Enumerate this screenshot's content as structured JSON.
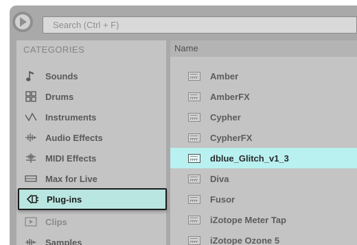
{
  "search": {
    "placeholder": "Search (Ctrl + F)"
  },
  "categories": {
    "header": "CATEGORIES",
    "items": [
      {
        "label": "Sounds",
        "icon": "music-note-icon"
      },
      {
        "label": "Drums",
        "icon": "drum-grid-icon"
      },
      {
        "label": "Instruments",
        "icon": "waveform-icon"
      },
      {
        "label": "Audio Effects",
        "icon": "audio-effects-icon"
      },
      {
        "label": "MIDI Effects",
        "icon": "midi-effects-icon"
      },
      {
        "label": "Max for Live",
        "icon": "max-for-live-icon"
      },
      {
        "label": "Plug-ins",
        "icon": "plugin-icon",
        "selected": true
      },
      {
        "label": "Clips",
        "icon": "clip-icon"
      },
      {
        "label": "Samples",
        "icon": "sample-waveform-icon"
      }
    ]
  },
  "list": {
    "column_header": "Name",
    "items": [
      {
        "label": "Amber"
      },
      {
        "label": "AmberFX"
      },
      {
        "label": "Cypher"
      },
      {
        "label": "CypherFX"
      },
      {
        "label": "dblue_Glitch_v1_3",
        "selected": true
      },
      {
        "label": "Diva"
      },
      {
        "label": "Fusor"
      },
      {
        "label": "iZotope Meter Tap"
      },
      {
        "label": "iZotope Ozone 5"
      }
    ]
  },
  "colors": {
    "selection": "#b9e6e1",
    "panel": "#c4c4c4",
    "frame": "#a9a9a9"
  }
}
